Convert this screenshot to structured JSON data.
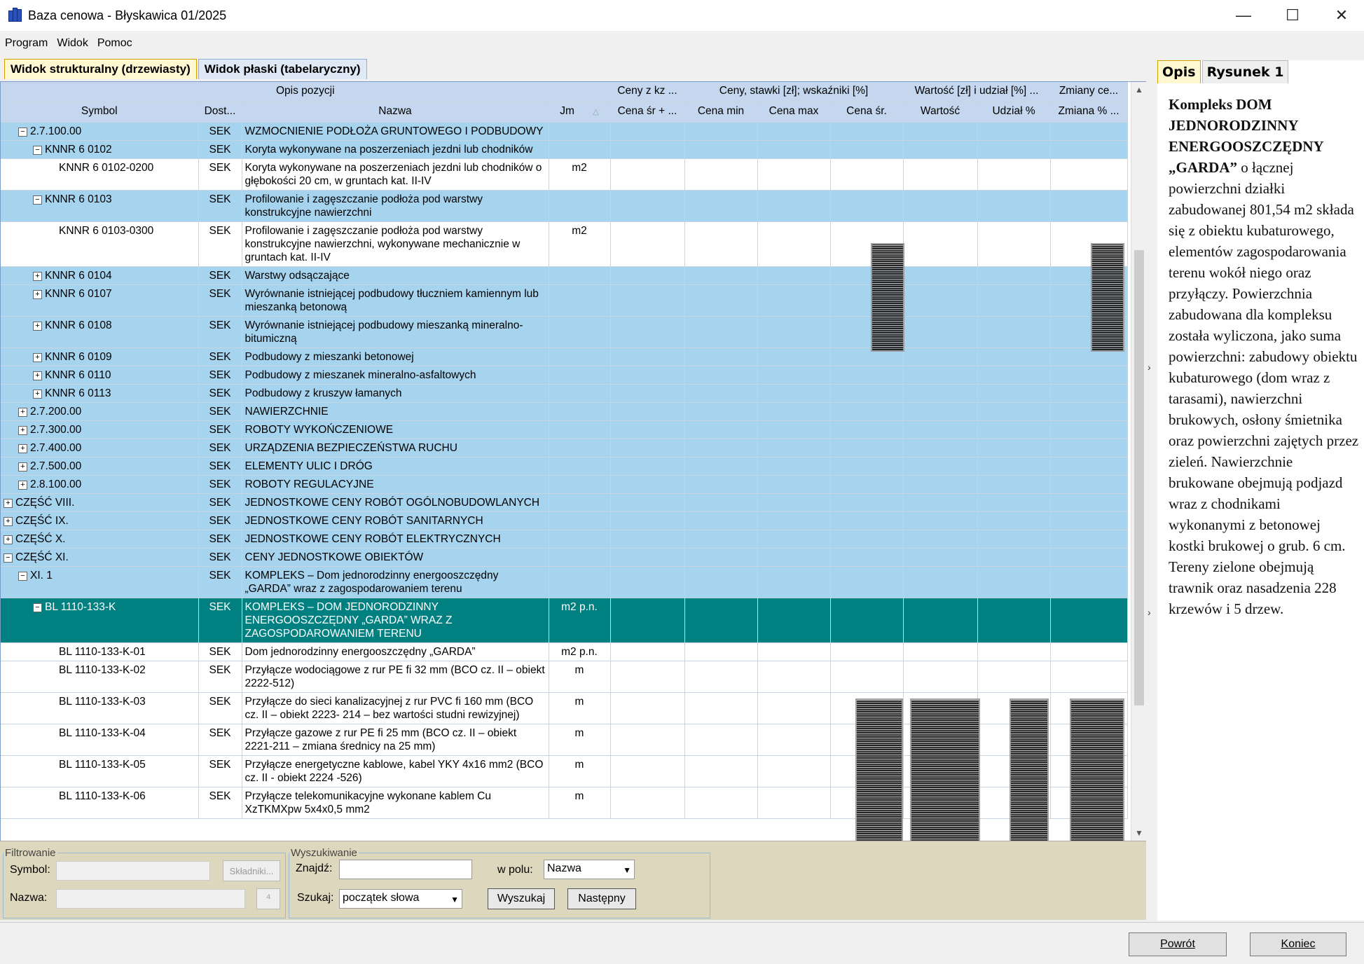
{
  "window": {
    "title": "Baza cenowa - Błyskawica 01/2025",
    "minimize": "—",
    "maximize": "☐",
    "close": "✕"
  },
  "menu": [
    "Program",
    "Widok",
    "Pomoc"
  ],
  "tabs": [
    "Widok strukturalny (drzewiasty)",
    "Widok płaski (tabelaryczny)"
  ],
  "grid": {
    "group_headers": [
      "Opis pozycji",
      "Ceny z kz ...",
      "Ceny, stawki [zł]; wskaźniki [%]",
      "Wartość [zł] i udział [%] ...",
      "Zmiany ce..."
    ],
    "columns": [
      "Symbol",
      "Dost...",
      "Nazwa",
      "Jm",
      "Cena śr + ...",
      "Cena min",
      "Cena max",
      "Cena śr.",
      "Wartość",
      "Udział %",
      "Zmiana % ..."
    ],
    "rows": [
      {
        "indent": 1,
        "toggle": "−",
        "symbol": "2.7.100.00",
        "dost": "SEK",
        "nazwa": "WZMOCNIENIE PODŁOŻA GRUNTOWEGO I PODBUDOWY",
        "jm": "",
        "style": "blue"
      },
      {
        "indent": 2,
        "toggle": "−",
        "symbol": "KNNR 6 0102",
        "dost": "SEK",
        "nazwa": "Koryta wykonywane na poszerzeniach jezdni lub chodników",
        "jm": "",
        "style": "blue"
      },
      {
        "indent": 3,
        "toggle": "",
        "symbol": "KNNR 6 0102-0200",
        "dost": "SEK",
        "nazwa": "Koryta wykonywane na poszerzeniach jezdni lub chodników o głębokości 20 cm, w gruntach kat. II-IV",
        "jm": "m2",
        "style": "white"
      },
      {
        "indent": 2,
        "toggle": "−",
        "symbol": "KNNR 6 0103",
        "dost": "SEK",
        "nazwa": "Profilowanie i zagęszczanie podłoża pod warstwy konstrukcyjne nawierzchni",
        "jm": "",
        "style": "blue"
      },
      {
        "indent": 3,
        "toggle": "",
        "symbol": "KNNR 6 0103-0300",
        "dost": "SEK",
        "nazwa": "Profilowanie i zagęszczanie podłoża pod warstwy konstrukcyjne nawierzchni, wykonywane mechanicznie w gruntach kat. II-IV",
        "jm": "m2",
        "style": "white"
      },
      {
        "indent": 2,
        "toggle": "+",
        "symbol": "KNNR 6 0104",
        "dost": "SEK",
        "nazwa": "Warstwy odsączające",
        "jm": "",
        "style": "blue"
      },
      {
        "indent": 2,
        "toggle": "+",
        "symbol": "KNNR 6 0107",
        "dost": "SEK",
        "nazwa": "Wyrównanie istniejącej podbudowy tłuczniem kamiennym lub mieszanką betonową",
        "jm": "",
        "style": "blue"
      },
      {
        "indent": 2,
        "toggle": "+",
        "symbol": "KNNR 6 0108",
        "dost": "SEK",
        "nazwa": "Wyrównanie istniejącej podbudowy mieszanką mineralno-bitumiczną",
        "jm": "",
        "style": "blue"
      },
      {
        "indent": 2,
        "toggle": "+",
        "symbol": "KNNR 6 0109",
        "dost": "SEK",
        "nazwa": "Podbudowy z mieszanki betonowej",
        "jm": "",
        "style": "blue"
      },
      {
        "indent": 2,
        "toggle": "+",
        "symbol": "KNNR 6 0110",
        "dost": "SEK",
        "nazwa": "Podbudowy z mieszanek mineralno-asfaltowych",
        "jm": "",
        "style": "blue"
      },
      {
        "indent": 2,
        "toggle": "+",
        "symbol": "KNNR 6 0113",
        "dost": "SEK",
        "nazwa": "Podbudowy z kruszyw łamanych",
        "jm": "",
        "style": "blue"
      },
      {
        "indent": 1,
        "toggle": "+",
        "symbol": "2.7.200.00",
        "dost": "SEK",
        "nazwa": "NAWIERZCHNIE",
        "jm": "",
        "style": "blue"
      },
      {
        "indent": 1,
        "toggle": "+",
        "symbol": "2.7.300.00",
        "dost": "SEK",
        "nazwa": "ROBOTY WYKOŃCZENIOWE",
        "jm": "",
        "style": "blue"
      },
      {
        "indent": 1,
        "toggle": "+",
        "symbol": "2.7.400.00",
        "dost": "SEK",
        "nazwa": "URZĄDZENIA BEZPIECZEŃSTWA RUCHU",
        "jm": "",
        "style": "blue"
      },
      {
        "indent": 1,
        "toggle": "+",
        "symbol": "2.7.500.00",
        "dost": "SEK",
        "nazwa": "ELEMENTY ULIC I DRÓG",
        "jm": "",
        "style": "blue"
      },
      {
        "indent": 1,
        "toggle": "+",
        "symbol": "2.8.100.00",
        "dost": "SEK",
        "nazwa": "ROBOTY REGULACYJNE",
        "jm": "",
        "style": "blue"
      },
      {
        "indent": 0,
        "toggle": "+",
        "symbol": "CZĘŚĆ VIII.",
        "dost": "SEK",
        "nazwa": "JEDNOSTKOWE CENY ROBÓT OGÓLNOBUDOWLANYCH",
        "jm": "",
        "style": "blue"
      },
      {
        "indent": 0,
        "toggle": "+",
        "symbol": "CZĘŚĆ IX.",
        "dost": "SEK",
        "nazwa": "JEDNOSTKOWE CENY ROBÓT SANITARNYCH",
        "jm": "",
        "style": "blue"
      },
      {
        "indent": 0,
        "toggle": "+",
        "symbol": "CZĘŚĆ X.",
        "dost": "SEK",
        "nazwa": "JEDNOSTKOWE CENY ROBÓT ELEKTRYCZNYCH",
        "jm": "",
        "style": "blue"
      },
      {
        "indent": 0,
        "toggle": "−",
        "symbol": "CZĘŚĆ XI.",
        "dost": "SEK",
        "nazwa": "CENY JEDNOSTKOWE OBIEKTÓW",
        "jm": "",
        "style": "blue"
      },
      {
        "indent": 1,
        "toggle": "−",
        "symbol": "XI. 1",
        "dost": "SEK",
        "nazwa": "KOMPLEKS – Dom jednorodzinny energooszczędny „GARDA” wraz z zagospodarowaniem terenu",
        "jm": "",
        "style": "blue"
      },
      {
        "indent": 2,
        "toggle": "−",
        "symbol": "BL 1110-133-K",
        "dost": "SEK",
        "nazwa": "KOMPLEKS – DOM JEDNORODZINNY ENERGOOSZCZĘDNY „GARDA” WRAZ Z ZAGOSPODAROWANIEM TERENU",
        "jm": "m2 p.n.",
        "style": "sel"
      },
      {
        "indent": 3,
        "toggle": "",
        "symbol": "BL 1110-133-K-01",
        "dost": "SEK",
        "nazwa": "Dom jednorodzinny energooszczędny „GARDA”",
        "jm": "m2 p.n.",
        "style": "white"
      },
      {
        "indent": 3,
        "toggle": "",
        "symbol": "BL 1110-133-K-02",
        "dost": "SEK",
        "nazwa": "Przyłącze wodociągowe z rur PE fi 32 mm (BCO cz. II – obiekt 2222-512)",
        "jm": "m",
        "style": "white"
      },
      {
        "indent": 3,
        "toggle": "",
        "symbol": "BL 1110-133-K-03",
        "dost": "SEK",
        "nazwa": "Przyłącze do sieci kanalizacyjnej z rur PVC fi 160 mm (BCO cz. II – obiekt 2223- 214 – bez wartości studni rewizyjnej)",
        "jm": "m",
        "style": "white"
      },
      {
        "indent": 3,
        "toggle": "",
        "symbol": "BL 1110-133-K-04",
        "dost": "SEK",
        "nazwa": "Przyłącze gazowe z rur PE fi 25 mm (BCO cz. II – obiekt 2221-211 – zmiana średnicy na 25 mm)",
        "jm": "m",
        "style": "white"
      },
      {
        "indent": 3,
        "toggle": "",
        "symbol": "BL 1110-133-K-05",
        "dost": "SEK",
        "nazwa": "Przyłącze energetyczne kablowe, kabel YKY 4x16 mm2 (BCO cz. II - obiekt 2224 -526)",
        "jm": "m",
        "style": "white"
      },
      {
        "indent": 3,
        "toggle": "",
        "symbol": "BL 1110-133-K-06",
        "dost": "SEK",
        "nazwa": "Przyłącze telekomunikacyjne wykonane kablem Cu XzTKMXpw 5x4x0,5 mm2",
        "jm": "m",
        "style": "white"
      }
    ]
  },
  "filter": {
    "legend": "Filtrowanie",
    "symbol_label": "Symbol:",
    "nazwa_label": "Nazwa:",
    "skladniki_button": "Składniki..."
  },
  "search": {
    "legend": "Wyszukiwanie",
    "znajdz_label": "Znajdź:",
    "znajdz_value": "",
    "wpolu_label": "w polu:",
    "wpolu_value": "Nazwa",
    "szukaj_label": "Szukaj:",
    "szukaj_value": "początek słowa",
    "search_button": "Wyszukaj",
    "next_button": "Następny"
  },
  "right": {
    "tabs": [
      "Opis",
      "Rysunek 1"
    ],
    "desc_bold": "Kompleks DOM JEDNORODZINNY ENERGOOSZCZĘDNY „GARDA”",
    "desc_rest": " o łącznej powierzchni działki zabudowanej 801,54 m2 składa się z obiektu kubaturowego, elementów zagospodarowania terenu wokół niego oraz przyłączy. Powierzchnia zabudowana dla kompleksu została wyliczona, jako suma powierzchni: zabudowy obiektu kubaturowego (dom wraz z tarasami), nawierzchni brukowych, osłony śmietnika oraz powierzchni zajętych przez zieleń. Nawierzchnie brukowane obejmują podjazd wraz z chodnikami wykonanymi z betonowej kostki brukowej o grub. 6 cm. Tereny zielone obejmują trawnik oraz nasadzenia 228 krzewów i 5 drzew."
  },
  "footer": {
    "back_button": "Powrót",
    "end_button": "Koniec"
  }
}
